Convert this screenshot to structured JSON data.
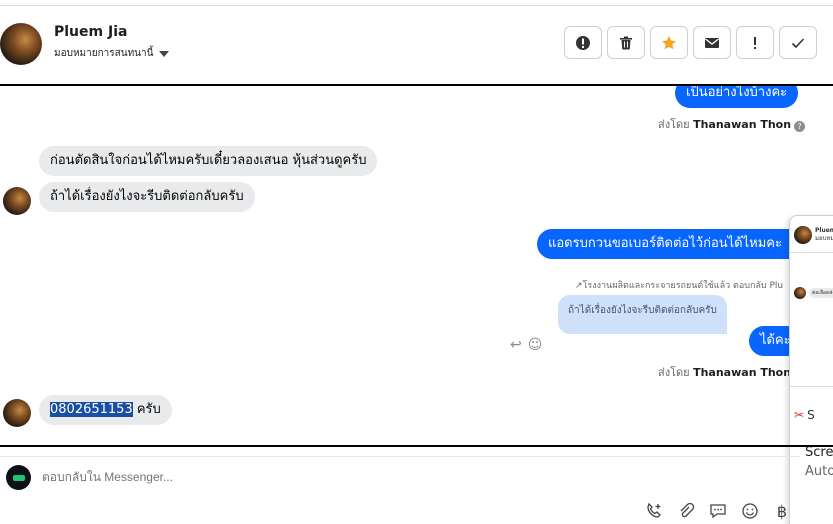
{
  "header": {
    "contact_name": "Pluem Jia",
    "assign_label": "มอบหมายการสนทนานี้",
    "actions": [
      "spam",
      "delete",
      "star",
      "mark-unread",
      "important",
      "done"
    ]
  },
  "messages": {
    "out_1": "เป็นอย่างไงบ้างคะ",
    "sent_by_1_prefix": "ส่งโดย",
    "sent_by_1_name": "Thanawan Thon",
    "in_1": "ก่อนตัดสินใจก่อนได้ไหมครับเดี๋ยวลองเสนอ หุ้นส่วนดูครับ",
    "in_2": "ถ้าได้เรื่องยังไงจะรีบติดต่อกลับครับ",
    "out_2": "แอดรบกวนขอเบอร์ติดต่อไว้ก่อนได้ไหมคะ",
    "reply_caption": "↗โรงงานผลิตและกระจายรถยนต์ใช้แล้ว ตอบกลับ Plu",
    "quoted_text": "ถ้าได้เรื่องยังไงจะรีบติดต่อกลับครับ",
    "out_3": "ได้คะ",
    "sent_by_2_prefix": "ส่งโดย",
    "sent_by_2_name": "Thanawan Thon",
    "in_3_number": "0802651153",
    "in_3_rest": " ครับ"
  },
  "float_panel": {
    "name": "Pluem",
    "sub": "มอบหมาย",
    "pill": "ต่อเลือดส่งด",
    "item_label": "S",
    "line1": "Scree",
    "line2": "Auto"
  },
  "composer": {
    "placeholder": "ตอบกลับใน Messenger..."
  },
  "colors": {
    "accent": "#0866ff",
    "incoming_bubble": "#e9eaec",
    "star": "#f5a623"
  }
}
